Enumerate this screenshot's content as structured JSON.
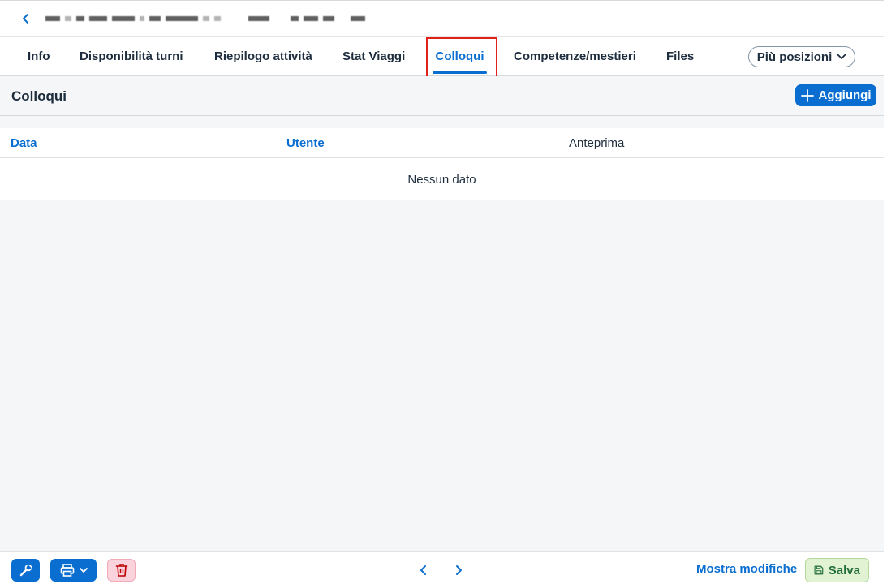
{
  "header": {
    "back_label": "<"
  },
  "tabs": [
    {
      "label": "Info",
      "active": false
    },
    {
      "label": "Disponibilità turni",
      "active": false
    },
    {
      "label": "Riepilogo attività",
      "active": false
    },
    {
      "label": "Stat Viaggi",
      "active": false
    },
    {
      "label": "Colloqui",
      "active": true
    },
    {
      "label": "Competenze/mestieri",
      "active": false
    },
    {
      "label": "Files",
      "active": false
    }
  ],
  "more_tabs_label": "Più posizioni",
  "section": {
    "title": "Colloqui",
    "add_label": "Aggiungi"
  },
  "table": {
    "columns": [
      "Data",
      "Utente",
      "Anteprima"
    ],
    "empty_text": "Nessun dato"
  },
  "footer": {
    "show_changes_label": "Mostra modifiche",
    "save_label": "Salva"
  },
  "colors": {
    "accent": "#0a6ed1",
    "highlight": "#e0211b",
    "delete_bg": "#fbd3dc",
    "save_bg": "#e2f3d3"
  }
}
